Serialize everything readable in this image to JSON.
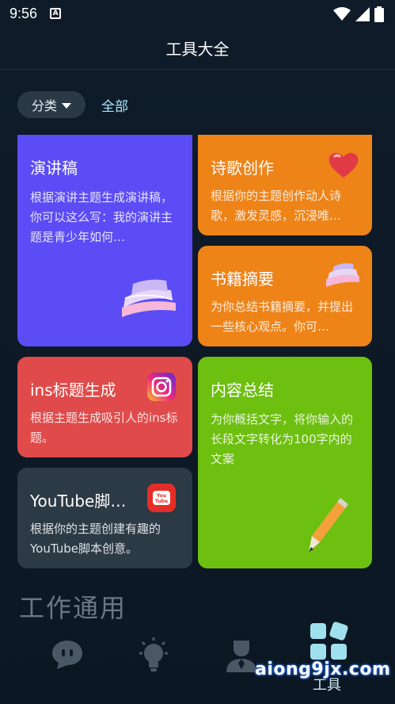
{
  "status_bar": {
    "time": "9:56",
    "notif_icon": "A"
  },
  "header": {
    "title": "工具大全"
  },
  "filter": {
    "category_label": "分类",
    "all_label": "全部"
  },
  "cards": [
    {
      "title": "演讲稿",
      "desc": "根据演讲主题生成演讲稿，你可以这么写：我的演讲主题是青少年如何…",
      "color": "#5b4cf5",
      "icon": "books-icon"
    },
    {
      "title": "诗歌创作",
      "desc": "根据你的主题创作动人诗歌，激发灵感，沉浸唯…",
      "color": "#ee8318",
      "icon": "heart-icon"
    },
    {
      "title": "书籍摘要",
      "desc": "为你总结书籍摘要，并提出一些核心观点。你可…",
      "color": "#ee8318",
      "icon": "books-icon"
    },
    {
      "title": "ins标题生成",
      "desc": "根据主题生成吸引人的ins标题。",
      "color": "#e04a4a",
      "icon": "instagram-icon"
    },
    {
      "title": "内容总结",
      "desc": "为你概括文字，将你输入的长段文字转化为100字内的文案",
      "color": "#6dbf10",
      "icon": "pen-icon"
    },
    {
      "title": "YouTube脚…",
      "desc": "根据你的主题创建有趣的YouTube脚本创意。",
      "color": "#2c3a46",
      "icon": "youtube-icon"
    }
  ],
  "section": {
    "title": "工作通用"
  },
  "bottom_nav": {
    "tools_label": "工具"
  },
  "watermark": "aiong9jx.com"
}
